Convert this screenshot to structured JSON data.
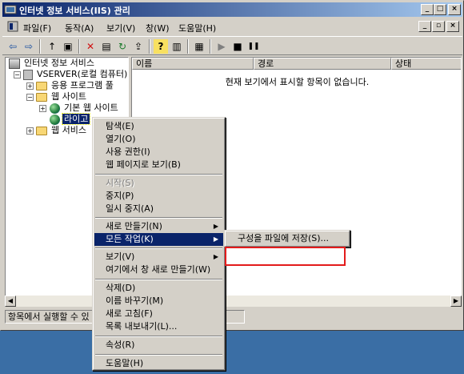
{
  "window": {
    "title": "인터넷 정보 서비스(IIS) 관리",
    "caption_buttons": [
      "_",
      "□",
      "×"
    ]
  },
  "menubar": {
    "items": [
      "파일(F)",
      "동작(A)",
      "보기(V)",
      "창(W)",
      "도움말(H)"
    ],
    "inner_buttons": [
      "_",
      "▫",
      "×"
    ]
  },
  "toolbar": {
    "buttons": [
      "back-icon",
      "forward-icon",
      "up-icon",
      "show-hide-tree-icon",
      "delete-icon",
      "properties-icon",
      "refresh-icon",
      "export-icon",
      "help-icon",
      "view-icon",
      "computer-icon",
      "play-icon",
      "stop-icon",
      "pause-icon"
    ],
    "glyphs": [
      "⇦",
      "⇨",
      "↑",
      "▣",
      "✕",
      "▤",
      "↻",
      "⇪",
      "?",
      "▥",
      "▦",
      "▶",
      "■",
      "❚❚"
    ]
  },
  "tree": {
    "nodes": [
      {
        "label": "인터넷 정보 서비스"
      },
      {
        "label": "VSERVER(로컬 컴퓨터)"
      },
      {
        "label": "응용 프로그램 풀"
      },
      {
        "label": "웹 사이트"
      },
      {
        "label": "기본 웹 사이트"
      },
      {
        "label": "라이고"
      },
      {
        "label": "웹 서비스"
      }
    ]
  },
  "list": {
    "columns": [
      "이름",
      "경로",
      "상태"
    ],
    "empty_message": "현재 보기에서 표시할 항목이 없습니다."
  },
  "statusbar": {
    "text": "항목에서 실행할 수 있"
  },
  "context_menu": {
    "items": [
      {
        "label": "탐색(E)"
      },
      {
        "label": "열기(O)"
      },
      {
        "label": "사용 권한(I)"
      },
      {
        "label": "웹 페이지로 보기(B)"
      },
      {
        "label": "시작(S)"
      },
      {
        "label": "중지(P)"
      },
      {
        "label": "일시 중지(A)"
      },
      {
        "label": "새로 만들기(N)"
      },
      {
        "label": "모든 작업(K)"
      },
      {
        "label": "보기(V)"
      },
      {
        "label": "여기에서 창 새로 만들기(W)"
      },
      {
        "label": "삭제(D)"
      },
      {
        "label": "이름 바꾸기(M)"
      },
      {
        "label": "새로 고침(F)"
      },
      {
        "label": "목록 내보내기(L)..."
      },
      {
        "label": "속성(R)"
      },
      {
        "label": "도움말(H)"
      }
    ],
    "submenu_arrow": "▶"
  },
  "submenu": {
    "items": [
      {
        "label": "구성을 파일에 저장(S)..."
      }
    ]
  },
  "colors": {
    "selection": "#0a246a",
    "annotation": "#e31b1b",
    "desktop": "#3a6ea5"
  }
}
